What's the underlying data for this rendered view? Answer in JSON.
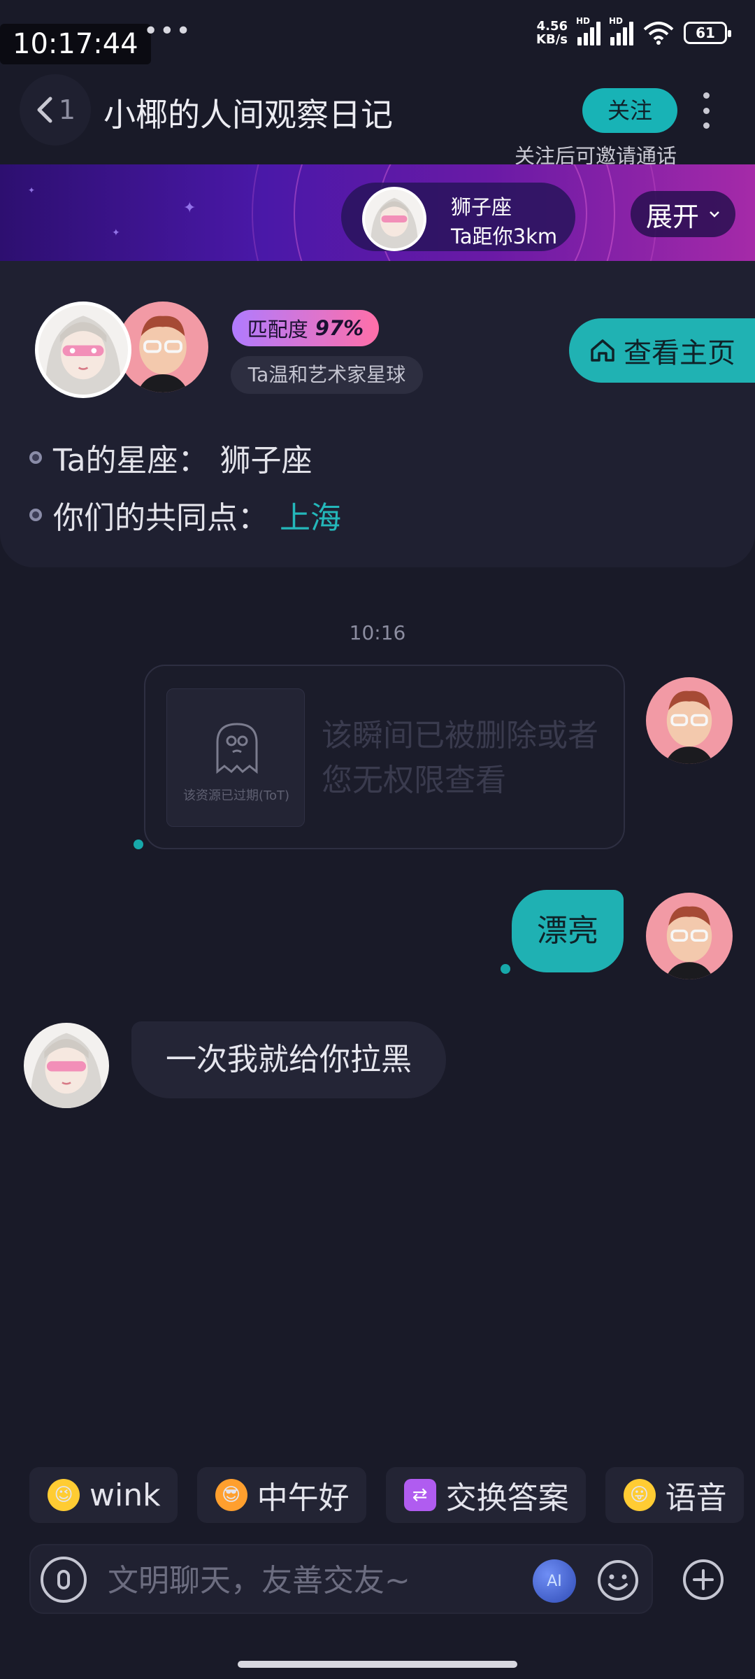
{
  "status_bar": {
    "time": "10:17:44",
    "net_speed_value": "4.56",
    "net_speed_unit": "KB/s",
    "hd_label": "HD",
    "battery": "61"
  },
  "header": {
    "back_count": "1",
    "title": "小椰的人间观察日记",
    "follow_label": "关注",
    "follow_hint": "关注后可邀请通话"
  },
  "banner": {
    "zodiac": "狮子座",
    "distance": "Ta距你3km",
    "expand_label": "展开"
  },
  "profile": {
    "match_label": "匹配度",
    "match_value": "97%",
    "planet_tag": "Ta温和艺术家星球",
    "homepage_label": "查看主页",
    "zodiac_label": "Ta的星座：",
    "zodiac_value": "狮子座",
    "common_label": "你们的共同点：",
    "common_value": "上海"
  },
  "chat": {
    "timestamp": "10:16",
    "deleted_notice": "该瞬间已被删除或者您无权限查看",
    "expired_caption": "该资源已过期(ToT)",
    "messages": [
      {
        "sender": "me",
        "text": "漂亮"
      },
      {
        "sender": "her",
        "text": "一次我就给你拉黑"
      }
    ]
  },
  "quick_replies": [
    {
      "emoji": "😉",
      "label": "wink"
    },
    {
      "emoji": "😎",
      "label": "中午好"
    },
    {
      "emoji": "⇄",
      "label": "交换答案"
    },
    {
      "emoji": "😛",
      "label": "语音"
    }
  ],
  "input": {
    "placeholder": "文明聊天，友善交友~"
  },
  "colors": {
    "background": "#191a28",
    "accent_teal": "#1fb1b3",
    "banner_purple": "#4a18a8"
  }
}
